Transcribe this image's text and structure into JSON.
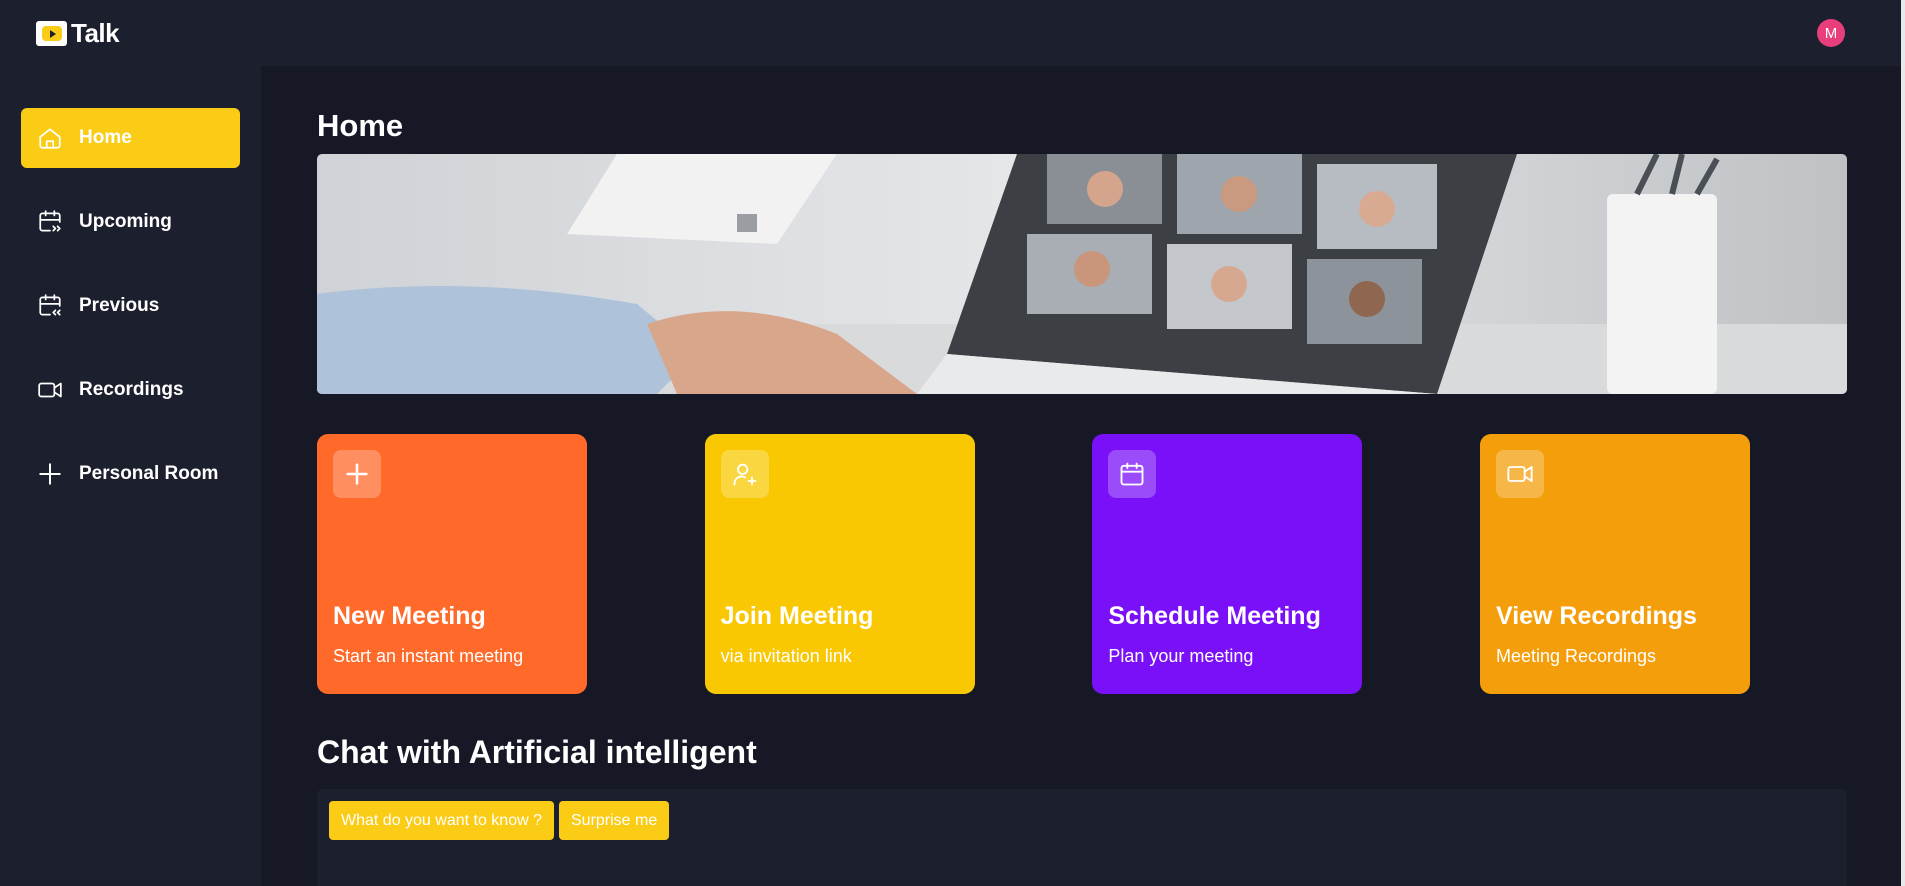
{
  "app": {
    "name": "Talk",
    "avatar_initial": "M"
  },
  "sidebar": {
    "items": [
      {
        "label": "Home",
        "icon": "home-icon",
        "active": true
      },
      {
        "label": "Upcoming",
        "icon": "calendar-forward-icon",
        "active": false
      },
      {
        "label": "Previous",
        "icon": "calendar-back-icon",
        "active": false
      },
      {
        "label": "Recordings",
        "icon": "video-icon",
        "active": false
      },
      {
        "label": "Personal Room",
        "icon": "plus-icon",
        "active": false
      }
    ]
  },
  "main": {
    "title": "Home",
    "cards": [
      {
        "title": "New Meeting",
        "subtitle": "Start an instant meeting",
        "icon": "plus-icon",
        "color": "#ff6a2b"
      },
      {
        "title": "Join Meeting",
        "subtitle": "via invitation link",
        "icon": "user-plus-icon",
        "color": "#f9c802"
      },
      {
        "title": "Schedule Meeting",
        "subtitle": "Plan your meeting",
        "icon": "calendar-icon",
        "color": "#7a10f8"
      },
      {
        "title": "View Recordings",
        "subtitle": "Meeting Recordings",
        "icon": "video-icon",
        "color": "#f59e0b"
      }
    ],
    "chat": {
      "title": "Chat with Artificial intelligent",
      "chips": [
        "What do you want to know ?",
        "Surprise me"
      ]
    }
  },
  "colors": {
    "accent": "#facc15",
    "background": "#1c1f2e",
    "main_bg": "#161925",
    "avatar": "#e83e7c"
  }
}
